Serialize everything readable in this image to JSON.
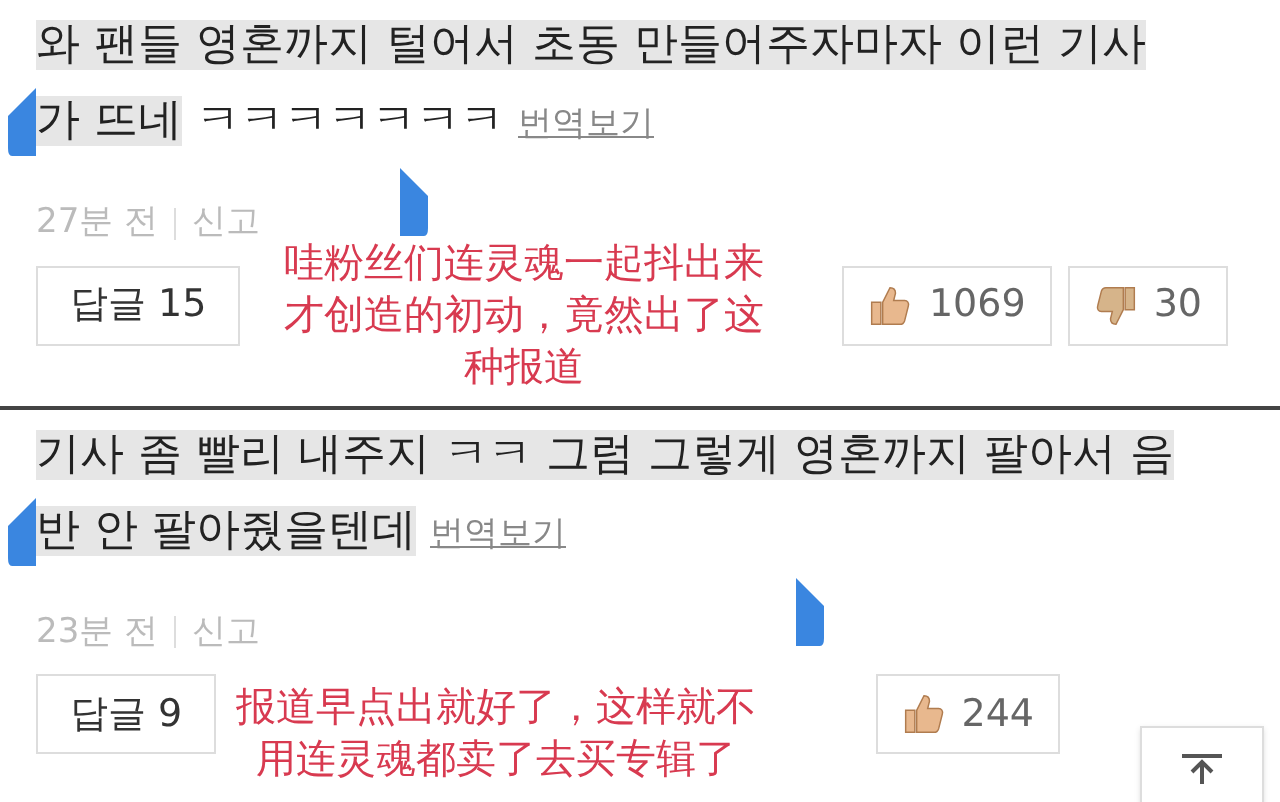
{
  "comments": [
    {
      "selected_text": "와 팬들 영혼까지 털어서 초동 만들어주자마자 이런 기사가 뜨네",
      "text": "ㅋㅋㅋㅋㅋㅋㅋ",
      "selected": true,
      "translate": "번역보기",
      "time": "27분 전",
      "report": "신고",
      "reply": "답글 15",
      "likes": "1069",
      "dislikes": "30",
      "annotation": [
        "哇粉丝们连灵魂一起抖出来",
        "才创造的初动，竟然出了这",
        "种报道"
      ]
    },
    {
      "selected_text": "기사 좀 빨리 내주지 ㅋㅋ 그럼 그렇게 영혼까지 팔아서 음반 안 팔아줬을텐데",
      "selected": true,
      "translate": "번역보기",
      "time": "23분 전",
      "report": "신고",
      "reply": "답글 9",
      "likes": "244",
      "annotation": [
        "报道早点出就好了，这样就不",
        "用连灵魂都卖了去买专辑了"
      ]
    }
  ]
}
